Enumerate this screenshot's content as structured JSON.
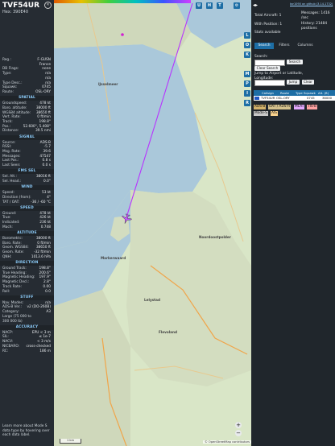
{
  "aircraft": {
    "callsign": "TVF54UR",
    "hex_label": "Hex: 390E40",
    "rows_top": [
      {
        "k": "Reg.:",
        "v": "F-GUSN"
      },
      {
        "k": "",
        "v": "France"
      },
      {
        "k": "DB Flags:",
        "v": "none"
      },
      {
        "k": "Type:",
        "v": "n/a"
      },
      {
        "k": "",
        "v": "n/a"
      },
      {
        "k": "Type Desc.:",
        "v": "n/a"
      },
      {
        "k": "Squawk:",
        "v": "0745"
      },
      {
        "k": "Route:",
        "v": "OSL-ORY"
      }
    ],
    "spatial_title": "SPATIAL",
    "spatial": [
      {
        "k": "Groundspeed:",
        "v": "478 kt"
      },
      {
        "k": "Baro. altitude:",
        "v": "38000 ft"
      },
      {
        "k": "WGS84 altitude:",
        "v": "38650 ft"
      },
      {
        "k": "Vert. Rate:",
        "v": "0 ft/min"
      },
      {
        "k": "Track:",
        "v": "198.8°"
      },
      {
        "k": "Pos.:",
        "v": "52.600°, 5.408°"
      },
      {
        "k": "Distance:",
        "v": "39.5 nmi"
      }
    ],
    "signal_title": "SIGNAL",
    "signal": [
      {
        "k": "Source:",
        "v": "ADS-B"
      },
      {
        "k": "RSSI:",
        "v": "-5.7"
      },
      {
        "k": "Msg. Rate:",
        "v": "39.6"
      },
      {
        "k": "Messages:",
        "v": "47547"
      },
      {
        "k": "Last Pos.:",
        "v": "0.8 s"
      },
      {
        "k": "Last Seen:",
        "v": "0.0 s"
      }
    ],
    "fms_title": "FMS SEL",
    "fms": [
      {
        "k": "Sel. Alt.:",
        "v": "38016 ft"
      },
      {
        "k": "Sel. Head.:",
        "v": "0.0°"
      }
    ],
    "wind_title": "WIND",
    "wind": [
      {
        "k": "Speed:",
        "v": "53 kt"
      },
      {
        "k": "Direction (from):",
        "v": "4°"
      },
      {
        "k": "TAT / OAT:",
        "v": "-36 / -60 °C"
      }
    ],
    "speed_title": "SPEED",
    "speed": [
      {
        "k": "Ground:",
        "v": "478 kt"
      },
      {
        "k": "True:",
        "v": "426 kt"
      },
      {
        "k": "Indicated:",
        "v": "236 kt"
      },
      {
        "k": "Mach:",
        "v": "0.748"
      }
    ],
    "altitude_title": "ALTITUDE",
    "altitude": [
      {
        "k": "Barometric:",
        "v": "38000 ft"
      },
      {
        "k": "Baro. Rate:",
        "v": "0 ft/min"
      },
      {
        "k": "Geom. WGS84:",
        "v": "38650 ft"
      },
      {
        "k": "Geom. Rate:",
        "v": "-32 ft/min"
      },
      {
        "k": "QNH:",
        "v": "1013.6 hPa"
      }
    ],
    "direction_title": "DIRECTION",
    "direction": [
      {
        "k": "Ground Track:",
        "v": "198.8°"
      },
      {
        "k": "True Heading:",
        "v": "200.6°"
      },
      {
        "k": "Magnetic Heading:",
        "v": "197.9°"
      },
      {
        "k": "Magnetic Decl.:",
        "v": "2.8°"
      },
      {
        "k": "Track Rate:",
        "v": "0.00"
      },
      {
        "k": "Roll:",
        "v": "0.0"
      }
    ],
    "stuff_title": "STUFF",
    "stuff": [
      {
        "k": "Nav. Modes:",
        "v": "n/a"
      },
      {
        "k": "ADS-B Ver.:",
        "v": "v2 (DO-260B)"
      },
      {
        "k": "Category:",
        "v": "A3"
      },
      {
        "k": "Large (75 000 to",
        "v": ""
      },
      {
        "k": "300 000 lb)",
        "v": ""
      }
    ],
    "accuracy_title": "ACCURACY",
    "accuracy": [
      {
        "k": "NACP:",
        "v": "EPU < 3 m"
      },
      {
        "k": "SIL:",
        "v": "≤ 1e-7"
      },
      {
        "k": "NACV:",
        "v": "< 3 m/s"
      },
      {
        "k": "NICBARO:",
        "v": "cross-checked"
      },
      {
        "k": "RC:",
        "v": "186 m"
      }
    ],
    "note": "Learn more about Mode S data type by hovering over each data label."
  },
  "map": {
    "top_buttons": [
      "U",
      "H",
      "T"
    ],
    "side_buttons": [
      "L",
      "O",
      "K",
      "M",
      "P",
      "I",
      "R"
    ],
    "places": [
      "IJsselmeer",
      "Lelystad",
      "Flevoland",
      "Noordoostpolder",
      "Markerwaard"
    ],
    "scale": "1 km",
    "attribution": "© OpenStreetMap contributors",
    "zoom_in": "+",
    "zoom_out": "−"
  },
  "right": {
    "update_link": "tar1090 on github (3.14.1732)",
    "stats": [
      {
        "k": "Total Aircraft:",
        "v": "1"
      },
      {
        "k": "With Position:",
        "v": "1"
      }
    ],
    "messages_label": "Messages: 1416 /sec",
    "history_label": "History: 21484 positions",
    "stats_link": "Stats available",
    "tabs": [
      "Search",
      "Filters",
      "Columns"
    ],
    "search_label": "Search:",
    "search_button": "Search",
    "clear_search": "Clear Search",
    "jump_label": "Jump to Airport or Latitude, Longitude:",
    "jump_button": "Jump",
    "clear_button": "Clear",
    "table_headers": [
      "Callsign",
      "Route",
      "Type",
      "Squawk",
      "Alt. (ft)"
    ],
    "table_row": [
      "TVF54UR",
      "OSL-ORY",
      "",
      "0745",
      "38000"
    ],
    "chips": [
      {
        "label": "ADS-B",
        "color": "#d3b36b"
      },
      {
        "label": "UAT / ADS-R",
        "color": "#d5c28d"
      },
      {
        "label": "MLAT",
        "color": "#e3a9ff"
      },
      {
        "label": "TIS-B",
        "color": "#ffa3a3"
      },
      {
        "label": "Mode-S",
        "color": "#c8c8c8"
      },
      {
        "label": "AIS",
        "color": "#f9d28e"
      }
    ]
  },
  "colors": {
    "accent": "#1d6ea5",
    "track": "#b833ff",
    "panel": "#262c33"
  }
}
